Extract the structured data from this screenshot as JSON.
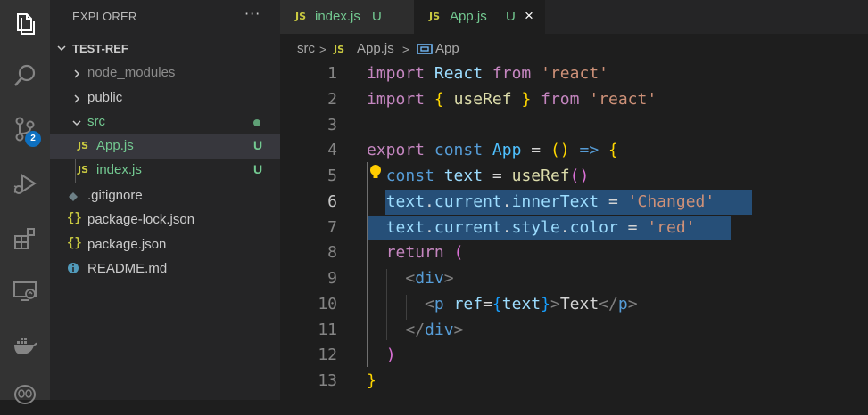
{
  "activity_bar": {
    "items": [
      {
        "name": "explorer-icon"
      },
      {
        "name": "search-icon"
      },
      {
        "name": "source-control-icon",
        "badge": "2"
      },
      {
        "name": "run-debug-icon"
      },
      {
        "name": "extensions-icon"
      },
      {
        "name": "remote-explorer-icon"
      },
      {
        "name": "docker-icon"
      },
      {
        "name": "database-icon"
      }
    ]
  },
  "sidebar": {
    "title": "EXPLORER",
    "more_label": "···",
    "project": "TEST-REF",
    "tree": [
      {
        "label": "node_modules",
        "type": "folder"
      },
      {
        "label": "public",
        "type": "folder"
      },
      {
        "label": "src",
        "type": "folder-open"
      },
      {
        "label": "App.js",
        "type": "js",
        "status": "U"
      },
      {
        "label": "index.js",
        "type": "js",
        "status": "U"
      },
      {
        "label": ".gitignore",
        "type": "gitignore"
      },
      {
        "label": "package-lock.json",
        "type": "json"
      },
      {
        "label": "package.json",
        "type": "json"
      },
      {
        "label": "README.md",
        "type": "info"
      }
    ],
    "file_icon_text": "JS",
    "json_icon_text": "{}"
  },
  "tabs": [
    {
      "label": "index.js",
      "status": "U",
      "icon": "JS"
    },
    {
      "label": "App.js",
      "status": "U",
      "icon": "JS",
      "close": "×"
    }
  ],
  "breadcrumb": {
    "items": [
      "src",
      "App.js",
      "App"
    ],
    "sep": ">"
  },
  "editor": {
    "line_numbers": [
      "1",
      "2",
      "3",
      "4",
      "5",
      "6",
      "7",
      "8",
      "9",
      "10",
      "11",
      "12",
      "13"
    ],
    "lines": [
      "import React from 'react'",
      "import { useRef } from 'react'",
      "",
      "export const App = () => {",
      "  const text = useRef()",
      "  text.current.innerText = 'Changed'",
      "  text.current.style.color = 'red'",
      "  return (",
      "    <div>",
      "      <p ref={text}>Text</p>",
      "    </div>",
      "  )",
      "}"
    ]
  },
  "colors": {
    "accent": "#0e70c0",
    "git_untracked": "#73c991",
    "selection": "#264f78"
  }
}
